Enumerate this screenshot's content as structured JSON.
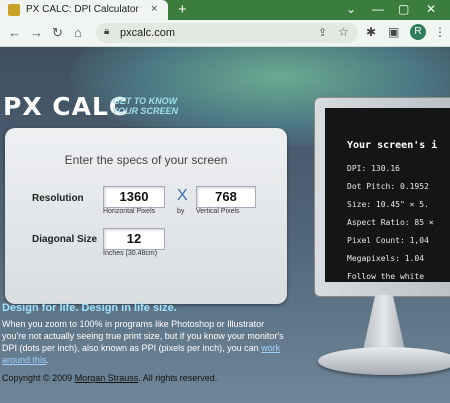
{
  "browser": {
    "tab_title": "PX CALC: DPI Calculator with Dot",
    "tab_close": "×",
    "new_tab": "+",
    "window_controls": [
      "⌄",
      "—",
      "▢",
      "✕"
    ],
    "url": "pxcalc.com",
    "profile_initial": "R",
    "icons": [
      "back-icon",
      "forward-icon",
      "reload-icon",
      "home-icon",
      "lock-icon",
      "share-icon",
      "star-icon",
      "extensions-icon",
      "sidebar-icon",
      "menu-icon"
    ]
  },
  "page": {
    "logo": "PX CALC",
    "tagline_line1": "GET TO KNOW",
    "tagline_line2": "YOUR SCREEN",
    "form": {
      "header": "Enter the specs of your screen",
      "resolution_label": "Resolution",
      "horizontal_value": "1360",
      "horizontal_caption": "Horizontal Pixels",
      "x_symbol": "X",
      "by_caption": "by",
      "vertical_value": "768",
      "vertical_caption": "Vertical Pixels",
      "diagonal_label": "Diagonal Size",
      "diagonal_value": "12",
      "diagonal_caption": "Inches (30.48cm)"
    },
    "headline": "Design for life. Design in life size.",
    "paragraph": {
      "text_before_link": "When you zoom to 100% in programs like Photoshop or Illustrator you're not actually seeing true print size, but if you know your monitor's DPI (dots per inch), also known as PPI (pixels per inch), you can ",
      "link": "work around this",
      "text_after_link": "."
    },
    "copyright": {
      "prefix": "Copyright © 2009 ",
      "author": "Morgan Strauss",
      "suffix": ". All rights reserved."
    },
    "monitor": {
      "title": "Your screen's i",
      "dpi": "DPI: 130.16",
      "dot_pitch": "Dot Pitch: 0.1952",
      "size": "Size: 10.45\" × 5.",
      "aspect": "Aspect Ratio: 85 ×",
      "pixel_count": "Pixel Count: 1,04",
      "megapixels": "Megapixels: 1.04",
      "follow": "Follow the white"
    }
  },
  "colors": {
    "tab_strip": "#3a7d3c",
    "page_bg": "#3f4f5e",
    "headline": "#9fe3ff",
    "accent_x": "#3a6fb0"
  }
}
